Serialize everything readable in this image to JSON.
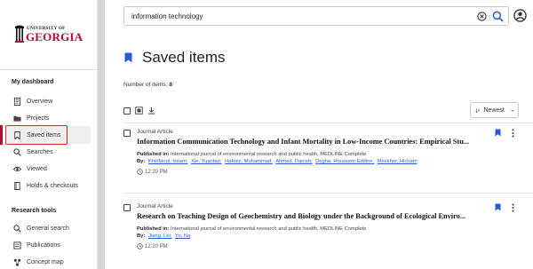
{
  "logo": {
    "small_text": "UNIVERSITY OF",
    "big_text": "GEORGIA"
  },
  "sidebar": {
    "dashboard_heading": "My dashboard",
    "dashboard_items": [
      {
        "label": "Overview",
        "icon": "document-icon"
      },
      {
        "label": "Projects",
        "icon": "folder-icon"
      },
      {
        "label": "Saved items",
        "icon": "bookmark-icon",
        "active": true
      },
      {
        "label": "Searches",
        "icon": "search-icon"
      },
      {
        "label": "Viewed",
        "icon": "eye-icon"
      },
      {
        "label": "Holds & checkouts",
        "icon": "book-icon"
      }
    ],
    "tools_heading": "Research tools",
    "tools_items": [
      {
        "label": "General search",
        "icon": "search-icon"
      },
      {
        "label": "Publications",
        "icon": "publication-icon"
      },
      {
        "label": "Concept map",
        "icon": "concept-map-icon"
      }
    ]
  },
  "search": {
    "value": "information technology"
  },
  "page": {
    "title": "Saved items",
    "count_label": "Number of items:",
    "count_value": "8"
  },
  "sort": {
    "selected": "Newest"
  },
  "results": [
    {
      "type": "Journal Article",
      "title": "Information Communication Technology and Infant Mortality in Low-Income Countries: Empirical Stu...",
      "published_label": "Published in:",
      "published_value": "International journal of environmental research and public health, MEDLINE Complete",
      "by_label": "By:",
      "authors": [
        "Khelfaoui, Issam;",
        "Xie, Yuantao;",
        "Hafeez, Muhammad;",
        "Ahmed, Danish;",
        "Degha, Houssem Eddine;",
        "Meskher, Hicham"
      ],
      "time": "12:20 PM"
    },
    {
      "type": "Journal Article",
      "title": "Research on Teaching Design of Geochemistry and Biology under the Background of Ecological Enviro...",
      "published_label": "Published in:",
      "published_value": "International journal of environmental research and public health, MEDLINE Complete",
      "by_label": "By:",
      "authors": [
        "Jiang, Lei;",
        "Yu, Na"
      ],
      "time": "12:20 PM"
    }
  ],
  "colors": {
    "accent": "#2a5bd7",
    "brand_red": "#ba0c2f"
  }
}
